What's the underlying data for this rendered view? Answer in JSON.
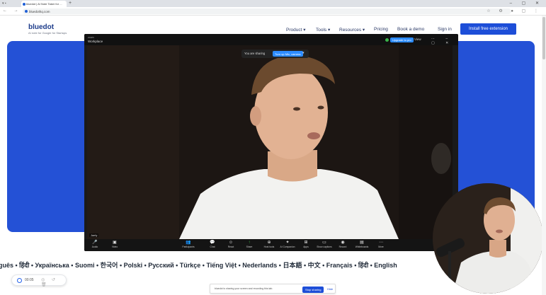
{
  "browser": {
    "tab_title": "bluedot | AI Note Taker for ...",
    "new_tab": "+",
    "url": "bluedothq.com",
    "window_controls": "– ▢ ✕"
  },
  "site": {
    "logo": "bluedot",
    "tagline": "AI note for Google for Startups",
    "nav": {
      "product": "Product ▾",
      "tools": "Tools ▾",
      "resources": "Resources ▾",
      "pricing": "Pricing",
      "book_demo": "Book a demo",
      "signin": "Sign in"
    },
    "install_button": "Install free extension"
  },
  "zoom": {
    "title_small": "zoom",
    "title": "Workplace",
    "upgrade": "Upgrade to pro",
    "view": "View",
    "share_bar": {
      "status": "You are sharing",
      "button": "Turn up Mic, camera",
      "caret": "▾"
    },
    "name_label": "Jaely",
    "toolbar": [
      {
        "id": "audio",
        "icon": "🎤",
        "label": "Audio"
      },
      {
        "id": "video",
        "icon": "▣",
        "label": "Video"
      },
      {
        "id": "participants",
        "icon": "👥",
        "label": "Participants"
      },
      {
        "id": "chat",
        "icon": "💬",
        "label": "Chat"
      },
      {
        "id": "react",
        "icon": "☺",
        "label": "React"
      },
      {
        "id": "share",
        "icon": "↑",
        "label": "Share"
      },
      {
        "id": "host-tools",
        "icon": "⊕",
        "label": "Host tools"
      },
      {
        "id": "ai-companion",
        "icon": "✦",
        "label": "AI Companion"
      },
      {
        "id": "apps",
        "icon": "⊞",
        "label": "Apps"
      },
      {
        "id": "captions",
        "icon": "▭",
        "label": "Show captions"
      },
      {
        "id": "record",
        "icon": "◉",
        "label": "Record"
      },
      {
        "id": "whiteboards",
        "icon": "▤",
        "label": "Whiteboards"
      },
      {
        "id": "more",
        "icon": "⋯",
        "label": "More"
      }
    ]
  },
  "languages": "guês • हिंदी • Українська • Suomi • 한국어 • Polski • Русский • Türkçe • Tiếng Việt • Nederlands • 日本語 • 中文 • Français • हिंदी • English",
  "recorder": {
    "time": "00:05"
  },
  "notice": {
    "message": "bluedot is sharing your screen and recording this tab.",
    "stop_button": "Stop sharing",
    "hide": "Hide"
  }
}
